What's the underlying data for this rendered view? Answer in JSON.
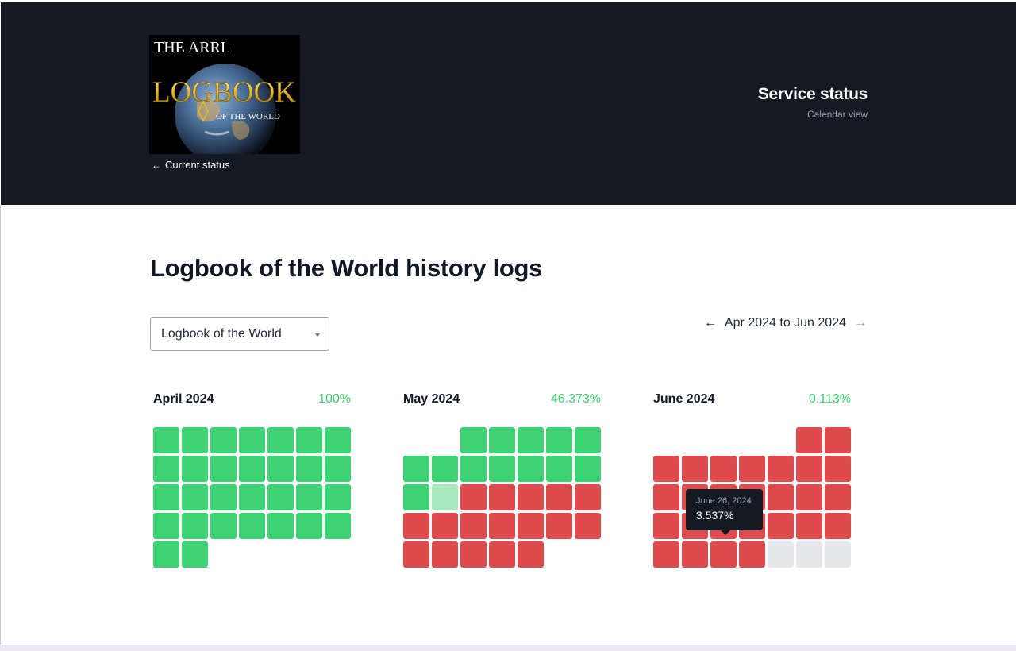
{
  "header": {
    "logo": {
      "line1": "THE ARRL",
      "line2": "LOGBOOK",
      "line3": "OF THE WORLD"
    },
    "back_link": "Current status",
    "service_title": "Service status",
    "service_subtitle": "Calendar view"
  },
  "main": {
    "page_title": "Logbook of the World history logs",
    "selector_value": "Logbook of the World",
    "date_range": "Apr 2024 to Jun 2024"
  },
  "legend_colors": {
    "operational": "#3dd273",
    "partial": "#a6e8bb",
    "outage": "#df4a4d",
    "no_data": "#e5e7eb"
  },
  "months": [
    {
      "name": "April 2024",
      "uptime": "100%",
      "leading_blanks": 0,
      "days": [
        "ok",
        "ok",
        "ok",
        "ok",
        "ok",
        "ok",
        "ok",
        "ok",
        "ok",
        "ok",
        "ok",
        "ok",
        "ok",
        "ok",
        "ok",
        "ok",
        "ok",
        "ok",
        "ok",
        "ok",
        "ok",
        "ok",
        "ok",
        "ok",
        "ok",
        "ok",
        "ok",
        "ok",
        "ok",
        "ok"
      ]
    },
    {
      "name": "May 2024",
      "uptime": "46.373%",
      "leading_blanks": 2,
      "days": [
        "ok",
        "ok",
        "ok",
        "ok",
        "ok",
        "ok",
        "ok",
        "ok",
        "ok",
        "ok",
        "ok",
        "ok",
        "ok",
        "partial",
        "down",
        "down",
        "down",
        "down",
        "down",
        "down",
        "down",
        "down",
        "down",
        "down",
        "down",
        "down",
        "down",
        "down",
        "down",
        "down",
        "down"
      ]
    },
    {
      "name": "June 2024",
      "uptime": "0.113%",
      "leading_blanks": 5,
      "days": [
        "down",
        "down",
        "down",
        "down",
        "down",
        "down",
        "down",
        "down",
        "down",
        "down",
        "down",
        "down",
        "down",
        "down",
        "down",
        "down",
        "down",
        "down",
        "down",
        "down",
        "down",
        "down",
        "down",
        "down",
        "down",
        "down",
        "down",
        "future",
        "future",
        "future"
      ]
    }
  ],
  "tooltip": {
    "date": "June 26, 2024",
    "value": "3.537%"
  }
}
